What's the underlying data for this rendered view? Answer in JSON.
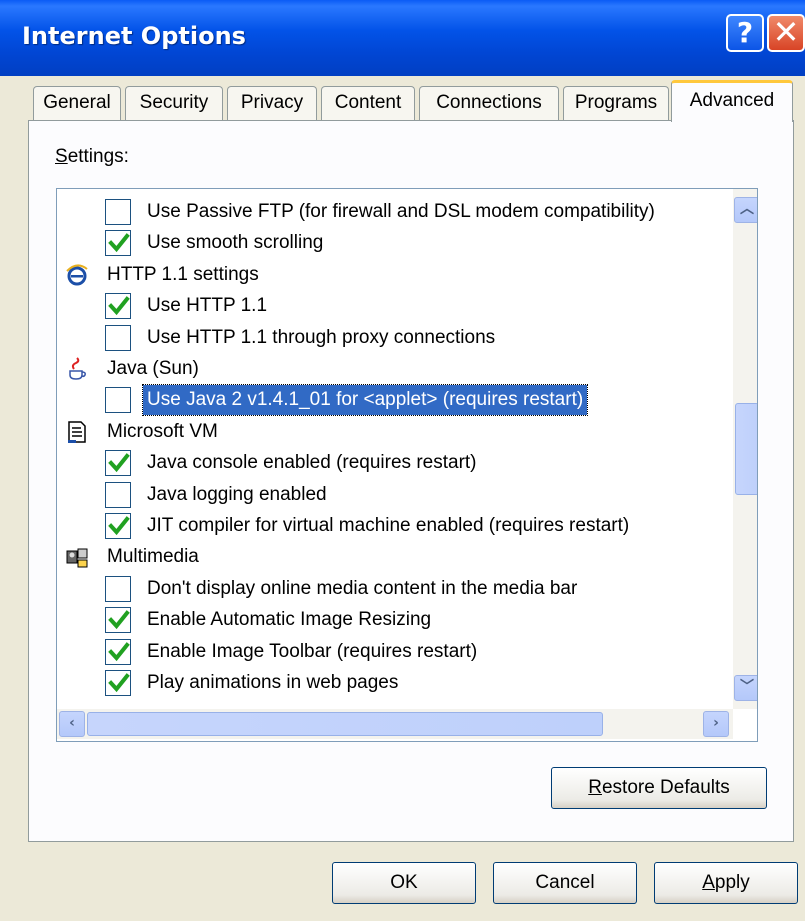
{
  "window": {
    "title": "Internet Options"
  },
  "titlebar": {
    "help_label": "?",
    "close_label": "✕"
  },
  "tabs": [
    {
      "label": "General",
      "active": false
    },
    {
      "label": "Security",
      "active": false
    },
    {
      "label": "Privacy",
      "active": false
    },
    {
      "label": "Content",
      "active": false
    },
    {
      "label": "Connections",
      "active": false
    },
    {
      "label": "Programs",
      "active": false
    },
    {
      "label": "Advanced",
      "active": true
    }
  ],
  "settings": {
    "label": "Settings:",
    "rows": [
      {
        "type": "checkbox",
        "checked": false,
        "label": "Use Passive FTP (for firewall and DSL modem compatibility)"
      },
      {
        "type": "checkbox",
        "checked": true,
        "label": "Use smooth scrolling"
      },
      {
        "type": "category",
        "icon": "ie-icon",
        "label": "HTTP 1.1 settings"
      },
      {
        "type": "checkbox",
        "checked": true,
        "label": "Use HTTP 1.1"
      },
      {
        "type": "checkbox",
        "checked": false,
        "label": "Use HTTP 1.1 through proxy connections"
      },
      {
        "type": "category",
        "icon": "java-icon",
        "label": "Java (Sun)"
      },
      {
        "type": "checkbox",
        "checked": false,
        "selected": true,
        "label": "Use Java 2 v1.4.1_01 for <applet> (requires restart)"
      },
      {
        "type": "category",
        "icon": "document-icon",
        "label": "Microsoft VM"
      },
      {
        "type": "checkbox",
        "checked": true,
        "label": "Java console enabled (requires restart)"
      },
      {
        "type": "checkbox",
        "checked": false,
        "label": "Java logging enabled"
      },
      {
        "type": "checkbox",
        "checked": true,
        "label": "JIT compiler for virtual machine enabled (requires restart)"
      },
      {
        "type": "category",
        "icon": "multimedia-icon",
        "label": "Multimedia"
      },
      {
        "type": "checkbox",
        "checked": false,
        "label": "Don't display online media content in the media bar"
      },
      {
        "type": "checkbox",
        "checked": true,
        "label": "Enable Automatic Image Resizing"
      },
      {
        "type": "checkbox",
        "checked": true,
        "label": "Enable Image Toolbar (requires restart)"
      },
      {
        "type": "checkbox",
        "checked": true,
        "label": "Play animations in web pages"
      }
    ]
  },
  "buttons": {
    "restore_defaults": "Restore Defaults",
    "ok": "OK",
    "cancel": "Cancel",
    "apply": "Apply"
  },
  "colors": {
    "titlebar": "#0353e8",
    "selection": "#316ac5",
    "check": "#21a121",
    "tab_highlight": "#ffc83c"
  }
}
